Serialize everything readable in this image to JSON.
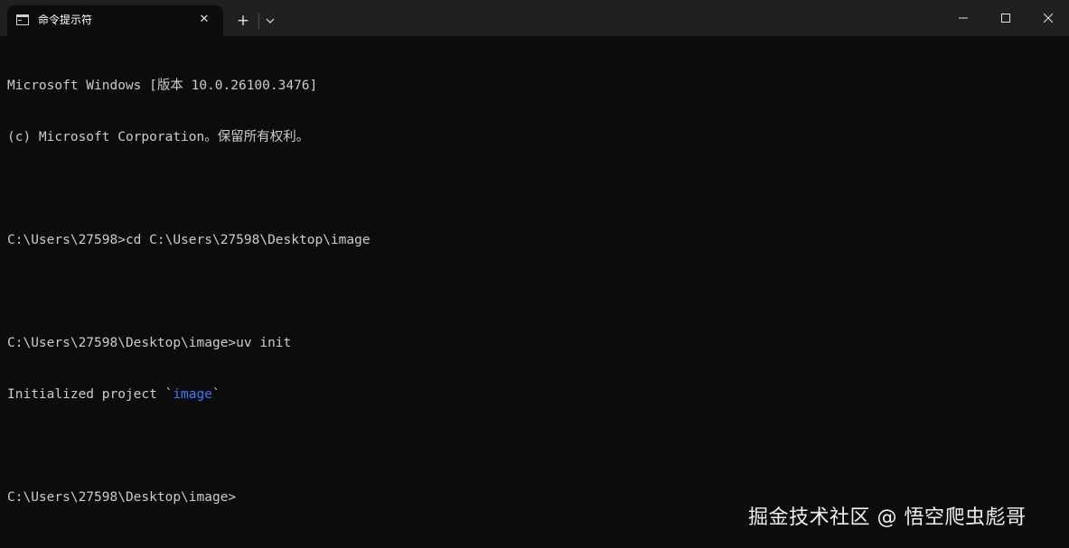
{
  "titlebar": {
    "tab_title": "命令提示符",
    "tab_close_label": "✕",
    "new_tab_label": "+",
    "dropdown_icon": "chevron-down-icon",
    "minimize_icon": "minimize-icon",
    "maximize_icon": "maximize-icon",
    "close_icon": "close-icon"
  },
  "terminal": {
    "lines": [
      "Microsoft Windows [版本 10.0.26100.3476]",
      "(c) Microsoft Corporation。保留所有权利。",
      "",
      "C:\\Users\\27598>cd C:\\Users\\27598\\Desktop\\image",
      "",
      "C:\\Users\\27598\\Desktop\\image>uv init",
      "",
      "",
      "C:\\Users\\27598\\Desktop\\image>"
    ],
    "init_prefix": "Initialized project `",
    "init_project": "image",
    "init_suffix": "`",
    "highlight_color": "#3b78ff",
    "text_color": "#cccccc",
    "background_color": "#0c0c0c"
  },
  "watermark": {
    "text": "掘金技术社区 @ 悟空爬虫彪哥"
  }
}
